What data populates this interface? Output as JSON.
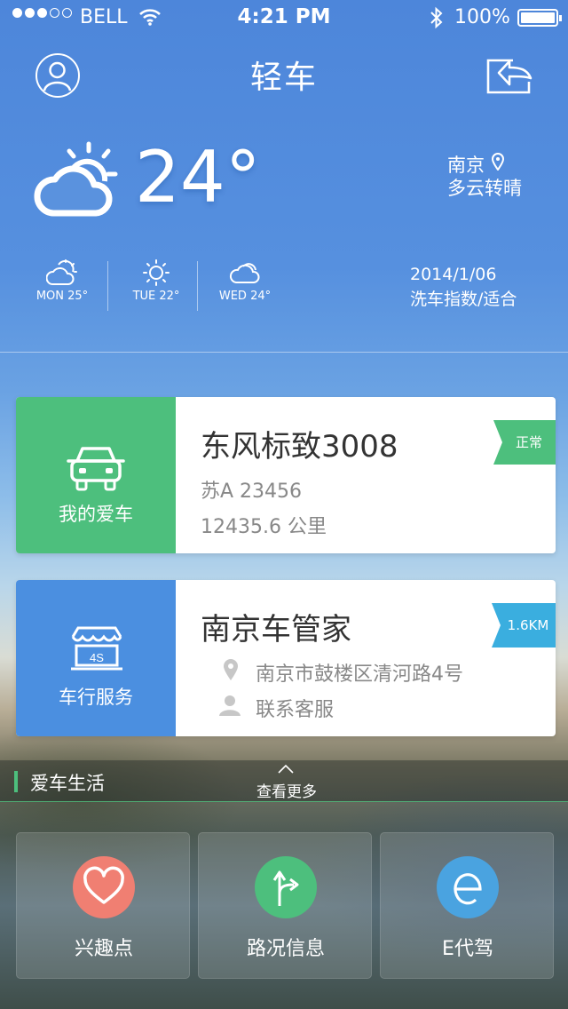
{
  "status_bar": {
    "carrier": "BELL",
    "time": "4:21 PM",
    "battery": "100%"
  },
  "nav": {
    "title": "轻车"
  },
  "weather": {
    "temperature": "24°",
    "city": "南京",
    "condition": "多云转晴",
    "forecast": [
      {
        "label": "MON 25°",
        "icon": "partly-cloudy-icon"
      },
      {
        "label": "TUE 22°",
        "icon": "sun-icon"
      },
      {
        "label": "WED 24°",
        "icon": "cloud-icon"
      }
    ],
    "date": "2014/1/06",
    "wash_index": "洗车指数/适合"
  },
  "my_car": {
    "side_label": "我的爱车",
    "model": "东风标致3008",
    "plate": "苏A 23456",
    "mileage": "12435.6 公里",
    "status_tag": "正常"
  },
  "service": {
    "side_label": "车行服务",
    "badge": "4S",
    "name": "南京车管家",
    "address": "南京市鼓楼区清河路4号",
    "contact": "联系客服",
    "distance": "1.6KM"
  },
  "life": {
    "title": "爱车生活",
    "more": "查看更多",
    "tiles": [
      {
        "label": "兴趣点",
        "color": "#f07f72",
        "icon": "heart-icon"
      },
      {
        "label": "路况信息",
        "color": "#4dbf7d",
        "icon": "route-icon"
      },
      {
        "label": "E代驾",
        "color": "#4aa3e0",
        "icon": "e-icon"
      }
    ]
  },
  "colors": {
    "green": "#4dbf7d",
    "blue": "#4b8fe0",
    "tag_blue": "#3aaedf"
  }
}
